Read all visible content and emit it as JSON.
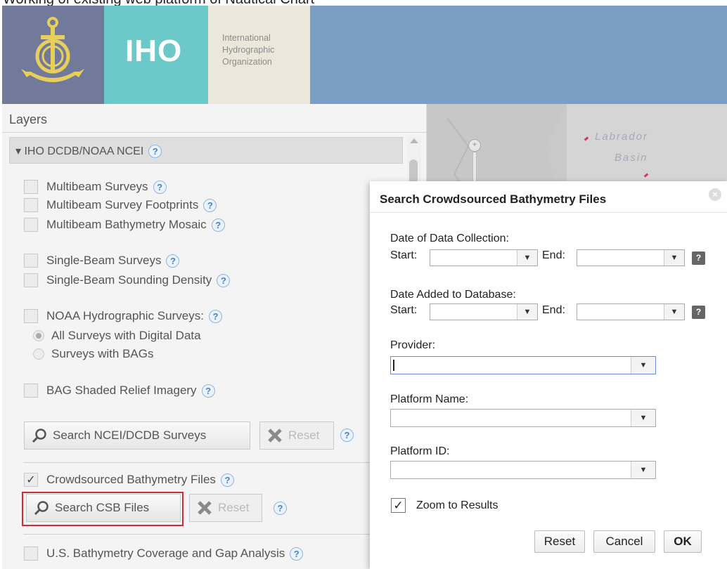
{
  "caption": "Working of existing web platform of Nautical Chart",
  "header": {
    "logo_name": "IHO",
    "org_line1": "International",
    "org_line2": "Hydrographic",
    "org_line3": "Organization"
  },
  "map": {
    "label_line1": "Labrador",
    "label_line2": "Basin",
    "zoom_symbol": "+"
  },
  "layers": {
    "title": "Layers",
    "group_title": "▾ IHO DCDB/NOAA NCEI",
    "help_symbol": "?",
    "items": {
      "multibeam_surveys": "Multibeam Surveys",
      "multibeam_footprints": "Multibeam Survey Footprints",
      "multibeam_mosaic": "Multibeam Bathymetry Mosaic",
      "single_beam_surveys": "Single-Beam Surveys",
      "single_beam_density": "Single-Beam Sounding Density",
      "noaa_hydro": "NOAA Hydrographic Surveys:",
      "all_surveys_radio": "All Surveys with Digital Data",
      "surveys_bags_radio": "Surveys with BAGs",
      "bag_relief": "BAG Shaded Relief Imagery",
      "crowdsourced": "Crowdsourced Bathymetry Files",
      "us_coverage": "U.S. Bathymetry Coverage and Gap Analysis"
    },
    "crowdsourced_check": "✓",
    "buttons": {
      "search_ncei": "Search NCEI/DCDB Surveys",
      "reset": "Reset",
      "search_csb": "Search CSB Files",
      "reset2": "Reset"
    }
  },
  "dialog": {
    "title": "Search Crowdsourced Bathymetry Files",
    "close_symbol": "×",
    "date_collection_label": "Date of Data Collection:",
    "date_added_label": "Date Added to Database:",
    "start_label": "Start:",
    "end_label": "End:",
    "dropdown_arrow": "▼",
    "qmark": "?",
    "provider_label": "Provider:",
    "platform_name_label": "Platform Name:",
    "platform_id_label": "Platform ID:",
    "zoom_label": "Zoom to Results",
    "zoom_check": "✓",
    "reset_button": "Reset",
    "cancel_button": "Cancel",
    "ok_button": "OK"
  }
}
